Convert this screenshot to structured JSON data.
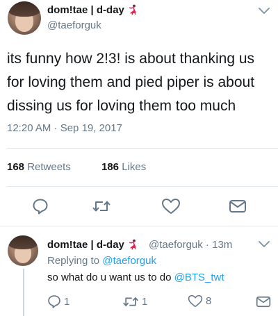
{
  "main_tweet": {
    "display_name": "dom!tae | d-day",
    "handle": "@taeforguk",
    "text": "its funny how 2!3! is about thanking us for loving them and pied piper is about dissing us for loving them too much",
    "timestamp": "12:20 AM · Sep 19, 2017",
    "retweets_count": "168",
    "retweets_label": "Retweets",
    "likes_count": "186",
    "likes_label": "Likes"
  },
  "reply_tweet": {
    "display_name": "dom!tae | d-day",
    "handle_time": "@taeforguk · 13m",
    "replying_prefix": "Replying to ",
    "replying_handle": "@taeforguk",
    "text_prefix": "so what do u want us to do ",
    "text_mention": "@BTS_twt",
    "reply_count": "1",
    "retweet_count": "1",
    "like_count": "8"
  },
  "colors": {
    "accent": "#1da1f2",
    "secondary_text": "#657786",
    "primary_text": "#14171a",
    "divider": "#e1e8ed"
  },
  "icons": [
    "dancer-emoji",
    "chevron-down-icon",
    "reply-icon",
    "retweet-icon",
    "like-icon",
    "share-icon"
  ]
}
